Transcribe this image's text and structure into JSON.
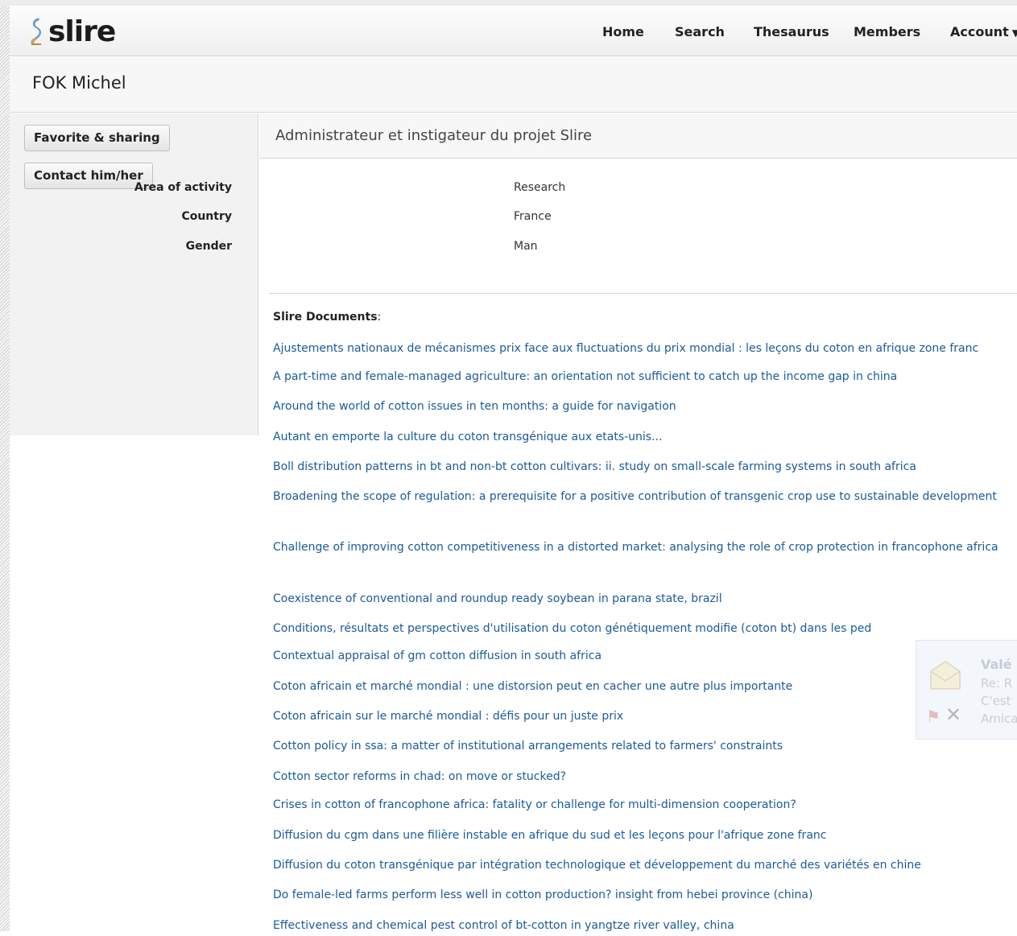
{
  "header": {
    "logo_text": "slire",
    "nav": [
      {
        "label": "Home"
      },
      {
        "label": "Search"
      },
      {
        "label": "Thesaurus"
      },
      {
        "label": "Members"
      },
      {
        "label": "Account",
        "has_dropdown": true
      }
    ]
  },
  "page": {
    "title": "FOK Michel"
  },
  "sidebar": {
    "buttons": [
      {
        "label": "Favorite & sharing"
      },
      {
        "label": "Contact him/her"
      }
    ]
  },
  "profile": {
    "subtitle": "Administrateur et instigateur du projet Slire",
    "fields": [
      {
        "label": "Area of activity",
        "value": "Research"
      },
      {
        "label": "Country",
        "value": "France"
      },
      {
        "label": "Gender",
        "value": "Man"
      }
    ]
  },
  "documents": {
    "title": "Slire Documents",
    "items": [
      "Ajustements nationaux de mécanismes prix face aux fluctuations du prix mondial : les leçons du coton en afrique zone franc",
      "A part-time and female-managed agriculture: an orientation not sufficient to catch up the income gap in china",
      "Around the world of cotton issues in ten months: a guide for navigation",
      "Autant en emporte la culture du coton transgénique aux etats-unis...",
      "Boll distribution patterns in bt and non-bt cotton cultivars: ii. study on small-scale farming systems in south africa",
      "Broadening the scope of regulation: a prerequisite for a positive contribution of transgenic crop use to sustainable development",
      "Challenge of improving cotton competitiveness in a distorted market: analysing the role of crop protection in francophone africa",
      "Coexistence of conventional and roundup ready soybean in parana state, brazil",
      "Conditions, résultats et perspectives d'utilisation du coton génétiquement modifie (coton bt) dans les ped",
      "Contextual appraisal of gm cotton diffusion in south africa",
      "Coton africain et marché mondial : une distorsion peut en cacher une autre plus importante",
      "Coton africain sur le marché mondial : défis pour un juste prix",
      "Cotton policy in ssa: a matter of institutional arrangements related to farmers' constraints",
      "Cotton sector reforms in chad: on move or stucked?",
      "Crises in cotton of francophone africa: fatality or challenge for multi-dimension cooperation?",
      "Diffusion du cgm dans une filière instable en afrique du sud et les leçons pour l'afrique zone franc",
      "Diffusion du coton transgénique par intégration technologique et développement du marché des variétés en chine",
      "Do female-led farms perform less well in cotton production? insight from hebei province (china)",
      "Effectiveness and chemical pest control of bt-cotton in yangtze river valley, china"
    ]
  },
  "notification": {
    "sender": "Valé",
    "line1": "Re: R",
    "line2": "C'est",
    "line3": "Amica"
  }
}
